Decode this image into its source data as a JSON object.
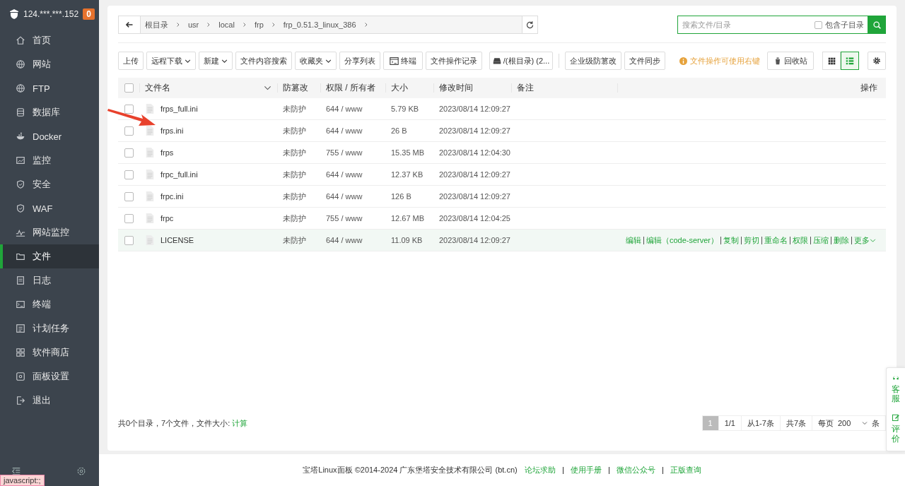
{
  "server": {
    "ip": "124.***.***.152",
    "badge": "0"
  },
  "sidebar": {
    "items": [
      {
        "label": "首页",
        "selected": false
      },
      {
        "label": "网站",
        "selected": false
      },
      {
        "label": "FTP",
        "selected": false
      },
      {
        "label": "数据库",
        "selected": false
      },
      {
        "label": "Docker",
        "selected": false
      },
      {
        "label": "监控",
        "selected": false
      },
      {
        "label": "安全",
        "selected": false
      },
      {
        "label": "WAF",
        "selected": false
      },
      {
        "label": "网站监控",
        "selected": false
      },
      {
        "label": "文件",
        "selected": true
      },
      {
        "label": "日志",
        "selected": false
      },
      {
        "label": "终端",
        "selected": false
      },
      {
        "label": "计划任务",
        "selected": false
      },
      {
        "label": "软件商店",
        "selected": false
      },
      {
        "label": "面板设置",
        "selected": false
      },
      {
        "label": "退出",
        "selected": false
      }
    ]
  },
  "breadcrumb": [
    "根目录",
    "usr",
    "local",
    "frp",
    "frp_0.51.3_linux_386"
  ],
  "search": {
    "placeholder": "搜索文件/目录",
    "include_subdirs": {
      "label": "包含子目录",
      "checked": false
    }
  },
  "toolbar": {
    "buttons": [
      {
        "label": "上传",
        "kind": "plain"
      },
      {
        "label": "远程下载",
        "kind": "dropdown"
      },
      {
        "label": "新建",
        "kind": "dropdown"
      },
      {
        "label": "文件内容搜索",
        "kind": "plain"
      },
      {
        "label": "收藏夹",
        "kind": "dropdown"
      },
      {
        "label": "分享列表",
        "kind": "plain"
      },
      {
        "label": "终端",
        "kind": "terminal"
      },
      {
        "label": "文件操作记录",
        "kind": "plain"
      },
      {
        "label": "/(根目录) (2...",
        "kind": "disk"
      },
      {
        "label": "企业级防篡改",
        "kind": "plain"
      },
      {
        "label": "文件同步",
        "kind": "plain"
      }
    ],
    "hint": "文件操作可使用右键",
    "recycle": "回收站",
    "views": [
      {
        "kind": "grid",
        "selected": false
      },
      {
        "kind": "list",
        "selected": true
      }
    ]
  },
  "table": {
    "select_all_checked": false,
    "columns": [
      "文件名",
      "防篡改",
      "权限 / 所有者",
      "大小",
      "修改时间",
      "备注",
      "操作"
    ],
    "rows": [
      {
        "checked": false,
        "name": "frps_full.ini",
        "protect": "未防护",
        "perm": "644 / www",
        "size": "5.79 KB",
        "mtime": "2023/08/14 12:09:27",
        "highlighted": false
      },
      {
        "checked": false,
        "name": "frps.ini",
        "protect": "未防护",
        "perm": "644 / www",
        "size": "26 B",
        "mtime": "2023/08/14 12:09:27",
        "highlighted": false
      },
      {
        "checked": false,
        "name": "frps",
        "protect": "未防护",
        "perm": "755 / www",
        "size": "15.35 MB",
        "mtime": "2023/08/14 12:04:30",
        "highlighted": false
      },
      {
        "checked": false,
        "name": "frpc_full.ini",
        "protect": "未防护",
        "perm": "644 / www",
        "size": "12.37 KB",
        "mtime": "2023/08/14 12:09:27",
        "highlighted": false
      },
      {
        "checked": false,
        "name": "frpc.ini",
        "protect": "未防护",
        "perm": "644 / www",
        "size": "126 B",
        "mtime": "2023/08/14 12:09:27",
        "highlighted": false
      },
      {
        "checked": false,
        "name": "frpc",
        "protect": "未防护",
        "perm": "755 / www",
        "size": "12.67 MB",
        "mtime": "2023/08/14 12:04:25",
        "highlighted": false
      },
      {
        "checked": false,
        "name": "LICENSE",
        "protect": "未防护",
        "perm": "644 / www",
        "size": "11.09 KB",
        "mtime": "2023/08/14 12:09:27",
        "highlighted": true,
        "actions": [
          "编辑",
          "编辑（code-server）",
          "复制",
          "剪切",
          "重命名",
          "权限",
          "压缩",
          "删除",
          "更多"
        ]
      }
    ]
  },
  "summary": {
    "text": "共0个目录，7个文件，文件大小:",
    "link": "计算"
  },
  "pagination": {
    "current": "1",
    "pages": "1/1",
    "range": "从1-7条",
    "total": "共7条",
    "per_page_label": "每页",
    "per_page": "200",
    "unit": "条"
  },
  "footer": {
    "copyright": "宝塔Linux面板 ©2014-2024 广东堡塔安全技术有限公司 (bt.cn)",
    "links": [
      "论坛求助",
      "使用手册",
      "微信公众号",
      "正版查询"
    ]
  },
  "side_widget": [
    "客服",
    "评价"
  ],
  "status_tip": "javascript:;"
}
